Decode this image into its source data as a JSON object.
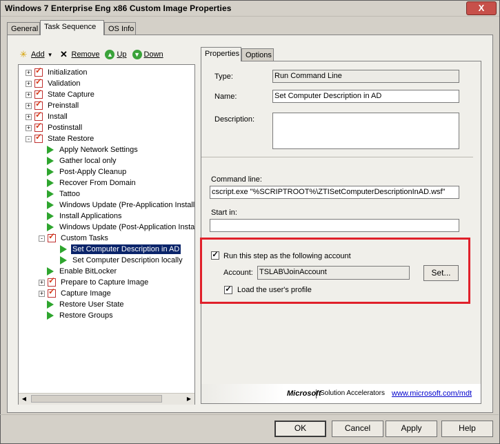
{
  "window": {
    "title": "Windows 7 Enterprise Eng x86 Custom Image Properties",
    "close_glyph": "X"
  },
  "tabs": [
    "General",
    "Task Sequence",
    "OS Info"
  ],
  "toolbar": {
    "add": "Add",
    "remove": "Remove",
    "up": "Up",
    "down": "Down"
  },
  "tree": {
    "items": [
      {
        "label": "Initialization",
        "type": "group",
        "expander": "+"
      },
      {
        "label": "Validation",
        "type": "group",
        "expander": "+"
      },
      {
        "label": "State Capture",
        "type": "group",
        "expander": "+"
      },
      {
        "label": "Preinstall",
        "type": "group",
        "expander": "+"
      },
      {
        "label": "Install",
        "type": "group",
        "expander": "+"
      },
      {
        "label": "Postinstall",
        "type": "group",
        "expander": "+"
      },
      {
        "label": "State Restore",
        "type": "group",
        "expander": "-"
      },
      {
        "label": "Apply Network Settings",
        "type": "step"
      },
      {
        "label": "Gather local only",
        "type": "step"
      },
      {
        "label": "Post-Apply Cleanup",
        "type": "step"
      },
      {
        "label": "Recover From Domain",
        "type": "step"
      },
      {
        "label": "Tattoo",
        "type": "step"
      },
      {
        "label": "Windows Update (Pre-Application Installation)",
        "type": "step"
      },
      {
        "label": "Install Applications",
        "type": "step"
      },
      {
        "label": "Windows Update (Post-Application Installation)",
        "type": "step"
      },
      {
        "label": "Custom Tasks",
        "type": "group",
        "expander": "-"
      },
      {
        "label": "Set Computer Description in AD",
        "type": "step",
        "selected": true
      },
      {
        "label": "Set Computer Description locally",
        "type": "step"
      },
      {
        "label": "Enable BitLocker",
        "type": "step"
      },
      {
        "label": "Prepare to Capture Image",
        "type": "group",
        "expander": "+"
      },
      {
        "label": "Capture Image",
        "type": "group",
        "expander": "+"
      },
      {
        "label": "Restore User State",
        "type": "step"
      },
      {
        "label": "Restore Groups",
        "type": "step"
      }
    ]
  },
  "inner_tabs": [
    "Properties",
    "Options"
  ],
  "properties": {
    "type_label": "Type:",
    "type_value": "Run Command Line",
    "name_label": "Name:",
    "name_value": "Set Computer Description in AD",
    "description_label": "Description:",
    "description_value": "",
    "command_label": "Command line:",
    "command_value": "cscript.exe \"%SCRIPTROOT%\\ZTISetComputerDescriptionInAD.wsf\"",
    "startin_label": "Start in:",
    "startin_value": "",
    "run_as_label": "Run this step as the following account",
    "run_as_checked": true,
    "account_label": "Account:",
    "account_value": "TSLAB\\JoinAccount",
    "set_button": "Set...",
    "load_profile_label": "Load the user's profile",
    "load_profile_checked": true
  },
  "banner": {
    "brand": "Microsoft",
    "product": "Solution Accelerators",
    "link": "www.microsoft.com/mdt"
  },
  "buttons": {
    "ok": "OK",
    "cancel": "Cancel",
    "apply": "Apply",
    "help": "Help"
  },
  "colors": {
    "selection": "#0a246a",
    "highlight_box": "#e0202a",
    "step_icon": "#2ea52e"
  }
}
